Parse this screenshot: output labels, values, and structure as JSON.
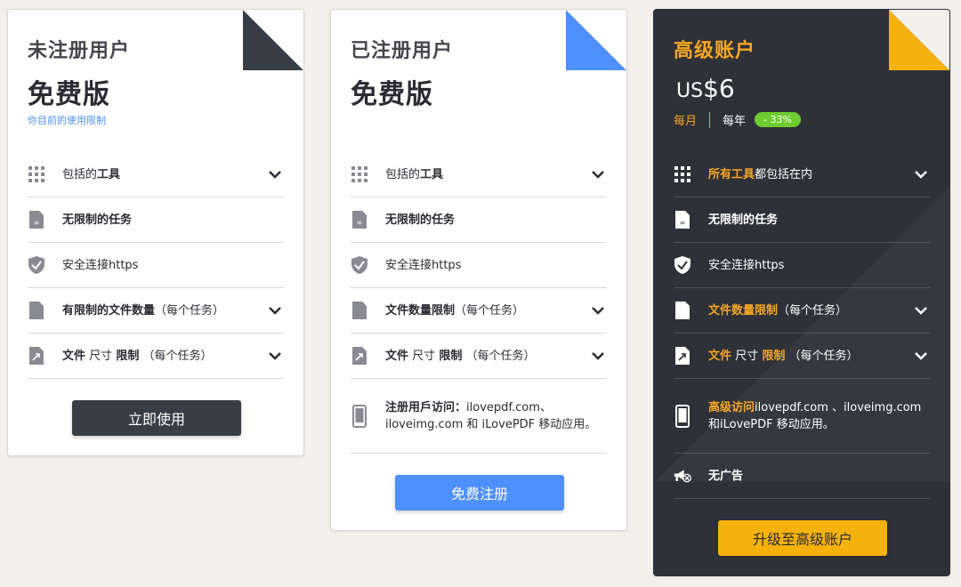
{
  "plans": {
    "free": {
      "title": "未注册用户",
      "subtitle": "免费版",
      "limit_link": "你目前的使用限制",
      "features": {
        "tools": {
          "a": "包括的",
          "b": "工具"
        },
        "unlimited": "无限制的任务",
        "secure": "安全连接https",
        "files": {
          "a": "有限制的文件数量",
          "b": "（每个任务）"
        },
        "size": {
          "a": "文件",
          "b": "尺寸",
          "c": "限制",
          "d": "（每个任务）"
        }
      },
      "button": "立即使用"
    },
    "registered": {
      "title": "已注册用户",
      "subtitle": "免费版",
      "features": {
        "tools": {
          "a": "包括的",
          "b": "工具"
        },
        "unlimited": "无限制的任务",
        "secure": "安全连接https",
        "files": {
          "a": "文件数量限制",
          "b": "（每个任务）"
        },
        "size": {
          "a": "文件",
          "b": "尺寸",
          "c": "限制",
          "d": "（每个任务）"
        },
        "access": {
          "a": "注册用戶访问：",
          "b": "ilovepdf.com、iloveimg.com 和 iLovePDF 移动应用。"
        }
      },
      "button": "免费注册"
    },
    "premium": {
      "title": "高级账户",
      "price_currency": "US",
      "price_amount": "$6",
      "monthly": "每月",
      "yearly": "每年",
      "discount": "- 33%",
      "features": {
        "tools": {
          "a": "所有工具",
          "b": "都包括在内"
        },
        "unlimited": "无限制的任务",
        "secure": "安全连接https",
        "files": {
          "a": "文件数量限制",
          "b": "（每个任务）"
        },
        "size": {
          "a": "文件",
          "b": "尺寸",
          "c": "限制",
          "d": "（每个任务）"
        },
        "access": {
          "a": "高级访问",
          "b": "ilovepdf.com 、iloveimg.com 和iLovePDF 移动应用。"
        },
        "noads": "无广告"
      },
      "button": "升级至高级账户"
    }
  },
  "colors": {
    "free_corner": "#383e45",
    "registered_corner": "#4d90fe",
    "premium_corner": "#f5b20c",
    "premium_bg": "#2f3138",
    "accent_gold": "#f5a623",
    "link_blue": "#4d90fe",
    "badge_green": "#6ecc2e"
  },
  "icons": [
    "grid-icon",
    "infinity-file-icon",
    "shield-check-icon",
    "file-icon",
    "file-resize-icon",
    "mobile-icon",
    "no-ads-megaphone-icon",
    "chevron-down-icon"
  ]
}
